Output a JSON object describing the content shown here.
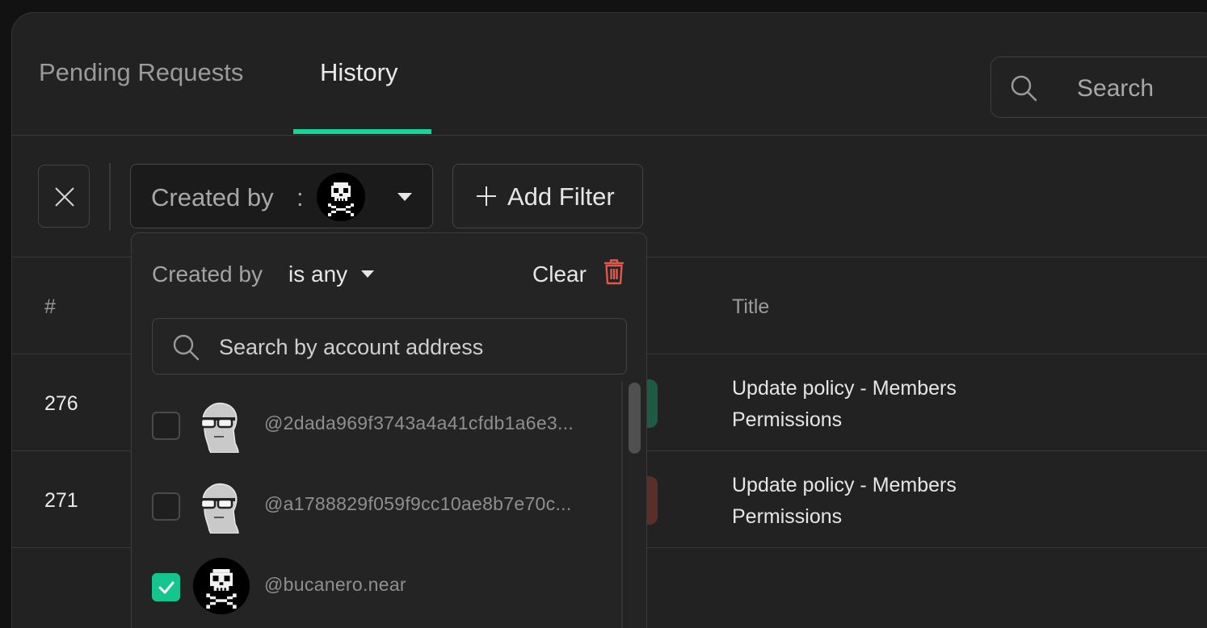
{
  "tabs": [
    {
      "label": "Pending Requests",
      "active": false
    },
    {
      "label": "History",
      "active": true
    }
  ],
  "search": {
    "placeholder": "Search"
  },
  "filter_bar": {
    "chip_label": "Created by",
    "chip_separator": ":",
    "add_filter_label": "Add Filter"
  },
  "table": {
    "columns": [
      "#",
      "Title"
    ],
    "rows": [
      {
        "num": "276",
        "title": "Update policy - Members Permissions",
        "status_color": "#1d5b45"
      },
      {
        "num": "271",
        "title": "Update policy - Members Permissions",
        "status_color": "#5a2f2a"
      }
    ]
  },
  "dropdown": {
    "field_label": "Created by",
    "operator": "is any",
    "clear_label": "Clear",
    "search_placeholder": "Search by account address",
    "accounts": [
      {
        "name": "@2dada969f3743a4a41cfdb1a6e3...",
        "checked": false,
        "avatar": "default-avatar"
      },
      {
        "name": "@a1788829f059f9cc10ae8b7e70c...",
        "checked": false,
        "avatar": "default-avatar"
      },
      {
        "name": "@bucanero.near",
        "checked": true,
        "avatar": "pixel-skull-avatar"
      }
    ]
  },
  "colors": {
    "accent": "#16d59a",
    "danger": "#e0584a",
    "background": "#222222"
  }
}
